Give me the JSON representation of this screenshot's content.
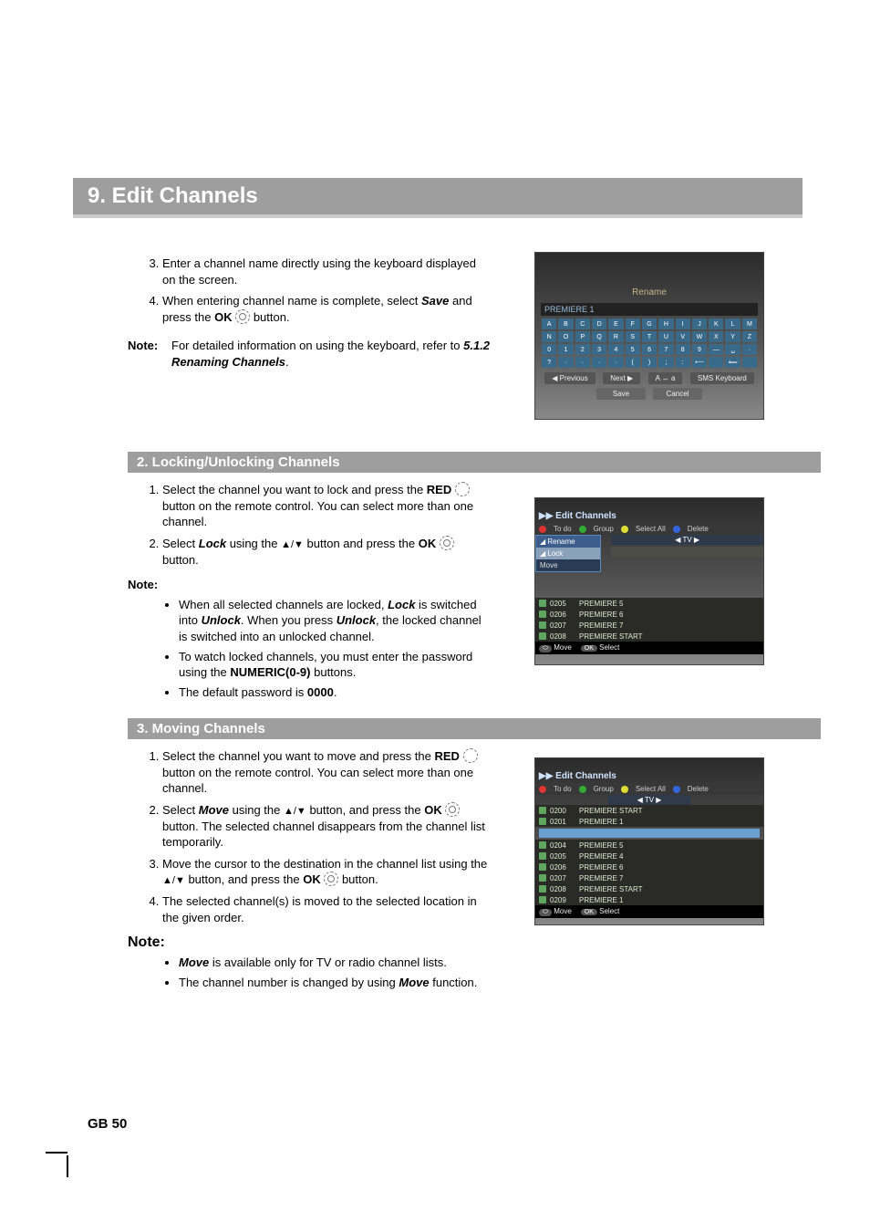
{
  "page": {
    "chapter_title": "9. Edit Channels",
    "footer": "GB 50"
  },
  "intro_steps": {
    "step3": "Enter a channel name directly using the keyboard displayed on the screen.",
    "step4_a": "When entering channel name is complete, select ",
    "step4_b_bold": "Save",
    "step4_c": " and press the ",
    "step4_d_bold": "OK",
    "step4_e": " button."
  },
  "intro_note": {
    "label": "Note:",
    "text_a": "For detailed information on using the keyboard, refer to ",
    "text_b_bi": "5.1.2 Renaming Channels",
    "text_c": "."
  },
  "section2": {
    "title": "2. Locking/Unlocking Channels",
    "step1_a": "Select the channel you want to lock and press the ",
    "step1_b_bold": "RED",
    "step1_c": " button on the remote control. You can select more than one channel.",
    "step2_a": "Select ",
    "step2_b_bi": "Lock",
    "step2_c": " using the ",
    "step2_d": " button and press the ",
    "step2_e_bold": "OK",
    "step2_f": " button.",
    "note_label": "Note:",
    "bullet1_a": "When all selected channels are locked, ",
    "bullet1_b_bi": "Lock",
    "bullet1_c": " is switched into ",
    "bullet1_d_bi": "Unlock",
    "bullet1_e": ". When you press ",
    "bullet1_f_bi": "Unlock",
    "bullet1_g": ", the locked channel is switched into an unlocked channel.",
    "bullet2_a": "To watch locked channels, you must enter the password using the ",
    "bullet2_b_bold": "NUMERIC(0-9)",
    "bullet2_c": " buttons.",
    "bullet3_a": "The default password is ",
    "bullet3_b_bold": "0000",
    "bullet3_c": "."
  },
  "section3": {
    "title": "3. Moving Channels",
    "step1_a": "Select the channel you want to move and press the ",
    "step1_b_bold": "RED",
    "step1_c": " button on the remote control. You can select more than one channel.",
    "step2_a": "Select ",
    "step2_b_bi": "Move",
    "step2_c": " using the ",
    "step2_d": " button, and press the ",
    "step2_e_bold": "OK",
    "step2_f": " button. The selected channel disappears from the channel list temporarily.",
    "step3_a": "Move the cursor to the destination in the channel list using the ",
    "step3_b": " button, and press the ",
    "step3_c_bold": "OK",
    "step3_d": " button.",
    "step4": "The selected channel(s) is moved to the selected location in the given order.",
    "note_label": "Note:",
    "bullet1_a_bi": "Move",
    "bullet1_b": " is available only for TV or radio channel lists.",
    "bullet2_a": "The channel number is changed by using ",
    "bullet2_b_bi": "Move",
    "bullet2_c": " function."
  },
  "screenshot1": {
    "title": "Rename",
    "field_value": "PREMIERE 1",
    "kb_rows": [
      [
        "A",
        "B",
        "C",
        "D",
        "E",
        "F",
        "G",
        "H",
        "I",
        "J",
        "K",
        "L",
        "M"
      ],
      [
        "N",
        "O",
        "P",
        "Q",
        "R",
        "S",
        "T",
        "U",
        "V",
        "W",
        "X",
        "Y",
        "Z"
      ],
      [
        "0",
        "1",
        "2",
        "3",
        "4",
        "5",
        "6",
        "7",
        "8",
        "9",
        "—",
        "␣",
        "·"
      ],
      [
        "?",
        "·",
        "·",
        "·",
        "·",
        "(",
        ")",
        ";",
        ":",
        "⟵",
        "",
        "⟸",
        ""
      ]
    ],
    "btn_prev": "◀ Previous",
    "btn_next": "Next  ▶",
    "btn_case": "A ↔ a",
    "btn_sms": "SMS Keyboard",
    "btn_save": "Save",
    "btn_cancel": "Cancel"
  },
  "screenshot2": {
    "header": "Edit Channels",
    "bar": {
      "todo": "To do",
      "group": "Group",
      "select_all": "Select All",
      "delete": "Delete"
    },
    "tab": "TV",
    "menu": {
      "rename": "Rename",
      "lock": "Lock",
      "move": "Move"
    },
    "rows": [
      {
        "num": "0205",
        "name": "PREMIERE 5"
      },
      {
        "num": "0206",
        "name": "PREMIERE 6"
      },
      {
        "num": "0207",
        "name": "PREMIERE 7"
      },
      {
        "num": "0208",
        "name": "PREMIERE START"
      }
    ],
    "foot_move": "Move",
    "foot_select": "Select"
  },
  "screenshot3": {
    "header": "Edit Channels",
    "bar": {
      "todo": "To do",
      "group": "Group",
      "select_all": "Select All",
      "delete": "Delete"
    },
    "tab": "TV",
    "rows_top": [
      {
        "num": "0200",
        "name": "PREMIERE START"
      },
      {
        "num": "0201",
        "name": "PREMIERE 1"
      }
    ],
    "rows_bottom": [
      {
        "num": "0204",
        "name": "PREMIERE 5"
      },
      {
        "num": "0205",
        "name": "PREMIERE 4"
      },
      {
        "num": "0206",
        "name": "PREMIERE 6"
      },
      {
        "num": "0207",
        "name": "PREMIERE 7"
      },
      {
        "num": "0208",
        "name": "PREMIERE START"
      },
      {
        "num": "0209",
        "name": "PREMIERE 1"
      }
    ],
    "foot_move": "Move",
    "foot_select": "Select"
  }
}
